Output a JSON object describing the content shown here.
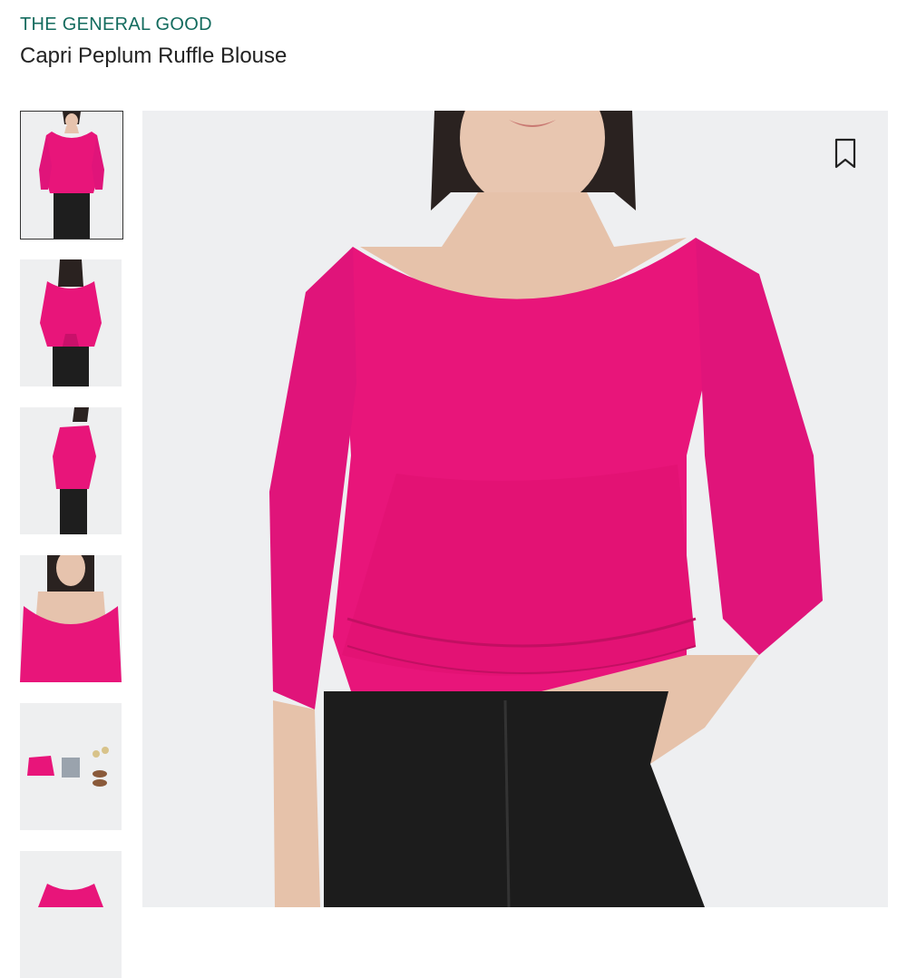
{
  "product": {
    "brand": "THE GENERAL GOOD",
    "name": "Capri Peplum Ruffle Blouse"
  },
  "gallery": {
    "thumbnails": [
      {
        "view": "front",
        "selected": true
      },
      {
        "view": "back",
        "selected": false
      },
      {
        "view": "side",
        "selected": false
      },
      {
        "view": "neckline-detail",
        "selected": false
      },
      {
        "view": "outfit-flatlay",
        "selected": false
      },
      {
        "view": "front-crop",
        "selected": false
      }
    ]
  },
  "colors": {
    "brand_text": "#136b5e",
    "title_text": "#222222",
    "blouse_pink": "#e8157a",
    "image_bg": "#eeeff1",
    "selected_border": "#333333"
  },
  "icons": {
    "bookmark": "bookmark-icon"
  }
}
